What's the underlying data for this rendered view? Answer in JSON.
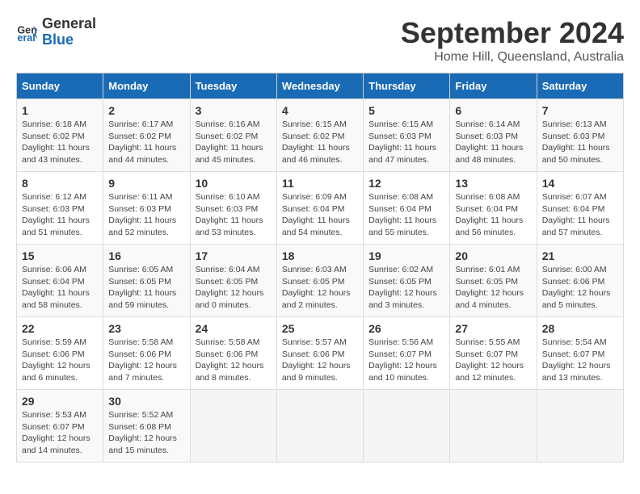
{
  "header": {
    "logo_line1": "General",
    "logo_line2": "Blue",
    "month": "September 2024",
    "location": "Home Hill, Queensland, Australia"
  },
  "days_of_week": [
    "Sunday",
    "Monday",
    "Tuesday",
    "Wednesday",
    "Thursday",
    "Friday",
    "Saturday"
  ],
  "weeks": [
    [
      {
        "day": "1",
        "info": "Sunrise: 6:18 AM\nSunset: 6:02 PM\nDaylight: 11 hours\nand 43 minutes."
      },
      {
        "day": "2",
        "info": "Sunrise: 6:17 AM\nSunset: 6:02 PM\nDaylight: 11 hours\nand 44 minutes."
      },
      {
        "day": "3",
        "info": "Sunrise: 6:16 AM\nSunset: 6:02 PM\nDaylight: 11 hours\nand 45 minutes."
      },
      {
        "day": "4",
        "info": "Sunrise: 6:15 AM\nSunset: 6:02 PM\nDaylight: 11 hours\nand 46 minutes."
      },
      {
        "day": "5",
        "info": "Sunrise: 6:15 AM\nSunset: 6:03 PM\nDaylight: 11 hours\nand 47 minutes."
      },
      {
        "day": "6",
        "info": "Sunrise: 6:14 AM\nSunset: 6:03 PM\nDaylight: 11 hours\nand 48 minutes."
      },
      {
        "day": "7",
        "info": "Sunrise: 6:13 AM\nSunset: 6:03 PM\nDaylight: 11 hours\nand 50 minutes."
      }
    ],
    [
      {
        "day": "8",
        "info": "Sunrise: 6:12 AM\nSunset: 6:03 PM\nDaylight: 11 hours\nand 51 minutes."
      },
      {
        "day": "9",
        "info": "Sunrise: 6:11 AM\nSunset: 6:03 PM\nDaylight: 11 hours\nand 52 minutes."
      },
      {
        "day": "10",
        "info": "Sunrise: 6:10 AM\nSunset: 6:03 PM\nDaylight: 11 hours\nand 53 minutes."
      },
      {
        "day": "11",
        "info": "Sunrise: 6:09 AM\nSunset: 6:04 PM\nDaylight: 11 hours\nand 54 minutes."
      },
      {
        "day": "12",
        "info": "Sunrise: 6:08 AM\nSunset: 6:04 PM\nDaylight: 11 hours\nand 55 minutes."
      },
      {
        "day": "13",
        "info": "Sunrise: 6:08 AM\nSunset: 6:04 PM\nDaylight: 11 hours\nand 56 minutes."
      },
      {
        "day": "14",
        "info": "Sunrise: 6:07 AM\nSunset: 6:04 PM\nDaylight: 11 hours\nand 57 minutes."
      }
    ],
    [
      {
        "day": "15",
        "info": "Sunrise: 6:06 AM\nSunset: 6:04 PM\nDaylight: 11 hours\nand 58 minutes."
      },
      {
        "day": "16",
        "info": "Sunrise: 6:05 AM\nSunset: 6:05 PM\nDaylight: 11 hours\nand 59 minutes."
      },
      {
        "day": "17",
        "info": "Sunrise: 6:04 AM\nSunset: 6:05 PM\nDaylight: 12 hours\nand 0 minutes."
      },
      {
        "day": "18",
        "info": "Sunrise: 6:03 AM\nSunset: 6:05 PM\nDaylight: 12 hours\nand 2 minutes."
      },
      {
        "day": "19",
        "info": "Sunrise: 6:02 AM\nSunset: 6:05 PM\nDaylight: 12 hours\nand 3 minutes."
      },
      {
        "day": "20",
        "info": "Sunrise: 6:01 AM\nSunset: 6:05 PM\nDaylight: 12 hours\nand 4 minutes."
      },
      {
        "day": "21",
        "info": "Sunrise: 6:00 AM\nSunset: 6:06 PM\nDaylight: 12 hours\nand 5 minutes."
      }
    ],
    [
      {
        "day": "22",
        "info": "Sunrise: 5:59 AM\nSunset: 6:06 PM\nDaylight: 12 hours\nand 6 minutes."
      },
      {
        "day": "23",
        "info": "Sunrise: 5:58 AM\nSunset: 6:06 PM\nDaylight: 12 hours\nand 7 minutes."
      },
      {
        "day": "24",
        "info": "Sunrise: 5:58 AM\nSunset: 6:06 PM\nDaylight: 12 hours\nand 8 minutes."
      },
      {
        "day": "25",
        "info": "Sunrise: 5:57 AM\nSunset: 6:06 PM\nDaylight: 12 hours\nand 9 minutes."
      },
      {
        "day": "26",
        "info": "Sunrise: 5:56 AM\nSunset: 6:07 PM\nDaylight: 12 hours\nand 10 minutes."
      },
      {
        "day": "27",
        "info": "Sunrise: 5:55 AM\nSunset: 6:07 PM\nDaylight: 12 hours\nand 12 minutes."
      },
      {
        "day": "28",
        "info": "Sunrise: 5:54 AM\nSunset: 6:07 PM\nDaylight: 12 hours\nand 13 minutes."
      }
    ],
    [
      {
        "day": "29",
        "info": "Sunrise: 5:53 AM\nSunset: 6:07 PM\nDaylight: 12 hours\nand 14 minutes."
      },
      {
        "day": "30",
        "info": "Sunrise: 5:52 AM\nSunset: 6:08 PM\nDaylight: 12 hours\nand 15 minutes."
      },
      {
        "day": "",
        "info": ""
      },
      {
        "day": "",
        "info": ""
      },
      {
        "day": "",
        "info": ""
      },
      {
        "day": "",
        "info": ""
      },
      {
        "day": "",
        "info": ""
      }
    ]
  ]
}
